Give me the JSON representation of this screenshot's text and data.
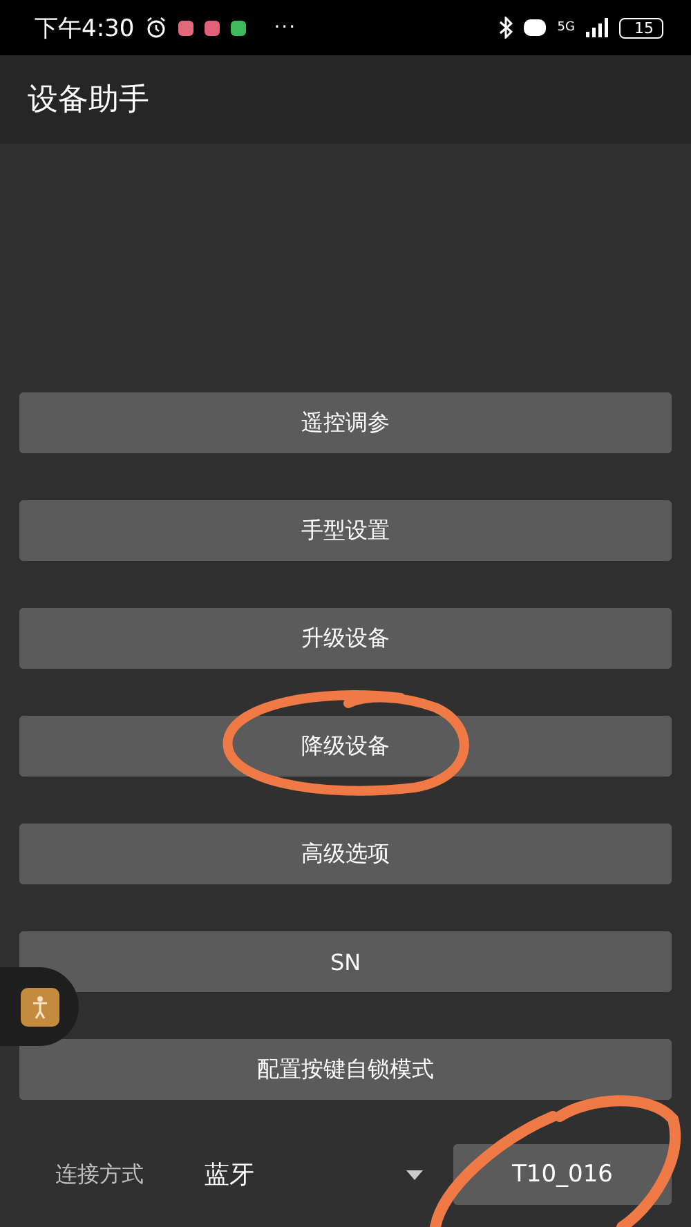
{
  "status_bar": {
    "time": "下午4:30",
    "more": "···",
    "network": "5G",
    "battery": "15"
  },
  "app_bar": {
    "title": "设备助手"
  },
  "menu_buttons": [
    "遥控调参",
    "手型设置",
    "升级设备",
    "降级设备",
    "高级选项",
    "SN",
    "配置按键自锁模式"
  ],
  "connection": {
    "label": "连接方式",
    "method": "蓝牙",
    "device": "T10_016"
  }
}
